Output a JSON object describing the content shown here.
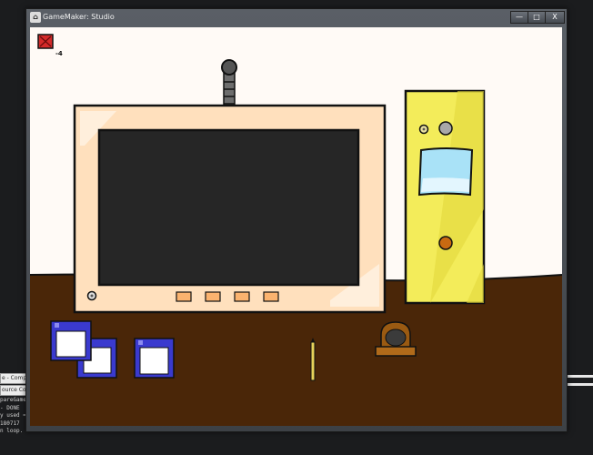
{
  "window": {
    "title": "GameMaker: Studio",
    "buttons": {
      "minimize": "—",
      "maximize": "□",
      "close": "X"
    }
  },
  "hud": {
    "counter": "-4"
  },
  "console": {
    "tabs": [
      "e - Compile",
      "ource Con"
    ],
    "lines": [
      "pareGame",
      "",
      "- DONE",
      "y used = 180717",
      "",
      "n loop.",
      ""
    ]
  },
  "colors": {
    "wall": "#fffaf6",
    "floor": "#4a2608",
    "tv_frame": "#ffe0bd",
    "screen": "#262626",
    "cabinet": "#f3ec5a",
    "floppy": "#3a3acf"
  }
}
